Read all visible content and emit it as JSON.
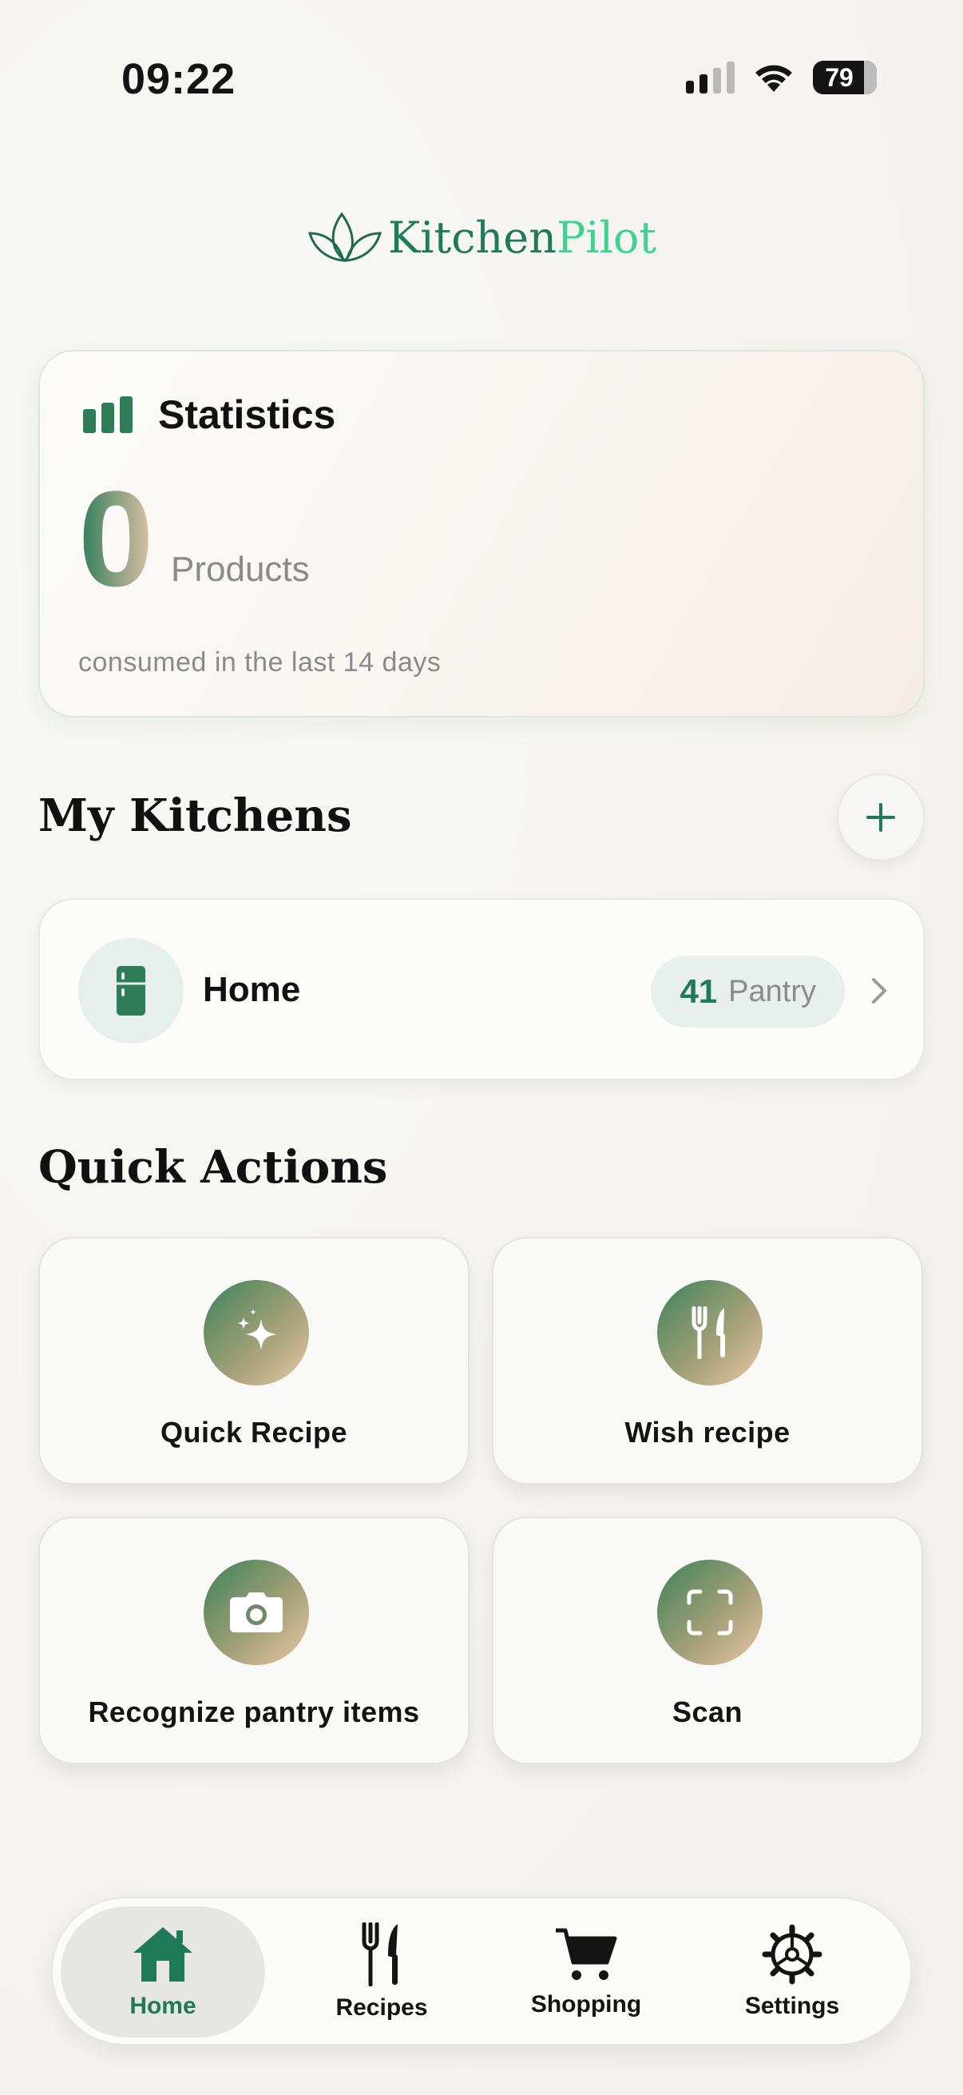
{
  "status_bar": {
    "time": "09:22",
    "battery": "79"
  },
  "app": {
    "name_part1": "Kitchen",
    "name_part2": "Pilot"
  },
  "statistics": {
    "title": "Statistics",
    "value": "0",
    "unit": "Products",
    "subtitle": "consumed in the last 14 days",
    "icon": "bar-chart-icon"
  },
  "kitchens": {
    "title": "My Kitchens",
    "add_icon": "plus-icon",
    "items": [
      {
        "name": "Home",
        "pantry_count": "41",
        "pantry_label": "Pantry",
        "icon": "fridge-icon"
      }
    ]
  },
  "quick_actions": {
    "title": "Quick Actions",
    "items": [
      {
        "label": "Quick Recipe",
        "icon": "sparkles-icon"
      },
      {
        "label": "Wish recipe",
        "icon": "fork-knife-icon"
      },
      {
        "label": "Recognize pantry items",
        "icon": "camera-icon"
      },
      {
        "label": "Scan",
        "icon": "scan-icon"
      }
    ]
  },
  "bottom_nav": {
    "items": [
      {
        "label": "Home",
        "icon": "home-icon",
        "active": true
      },
      {
        "label": "Recipes",
        "icon": "fork-knife-icon",
        "active": false
      },
      {
        "label": "Shopping",
        "icon": "cart-icon",
        "active": false
      },
      {
        "label": "Settings",
        "icon": "gear-icon",
        "active": false
      }
    ]
  },
  "colors": {
    "accent": "#1f7a5a",
    "accent_light": "#3fd18f",
    "background": "#f6f5f2"
  }
}
